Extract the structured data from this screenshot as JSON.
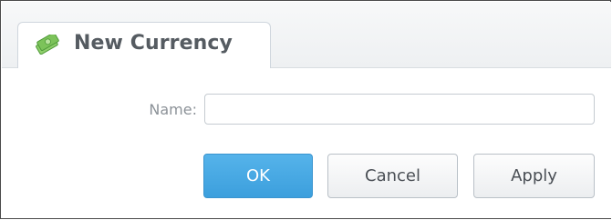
{
  "tab": {
    "title": "New Currency",
    "icon": "money-icon"
  },
  "form": {
    "name_label": "Name:",
    "name_value": "",
    "name_placeholder": ""
  },
  "buttons": {
    "ok_label": "OK",
    "cancel_label": "Cancel",
    "apply_label": "Apply"
  },
  "colors": {
    "accent": "#3c9fdd",
    "icon_green": "#5cb85c"
  }
}
